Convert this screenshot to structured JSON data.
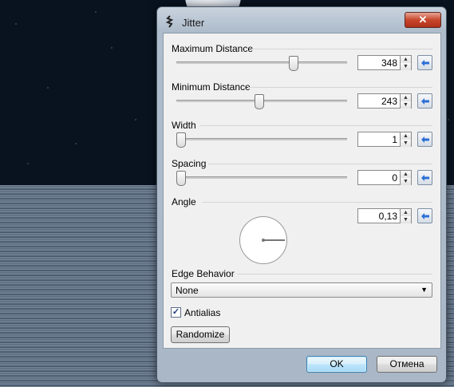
{
  "dialog": {
    "title": "Jitter",
    "close_glyph": "✕"
  },
  "fields": {
    "max_distance": {
      "label": "Maximum Distance",
      "value": "348",
      "slider_fraction": 0.69
    },
    "min_distance": {
      "label": "Minimum Distance",
      "value": "243",
      "slider_fraction": 0.48
    },
    "width": {
      "label": "Width",
      "value": "1",
      "slider_fraction": 0.0
    },
    "spacing": {
      "label": "Spacing",
      "value": "0",
      "slider_fraction": 0.0
    },
    "angle": {
      "label": "Angle",
      "value": "0,13"
    }
  },
  "spin_up_glyph": "▲",
  "spin_down_glyph": "▼",
  "edge_behavior": {
    "label": "Edge Behavior",
    "selected": "None",
    "arrow_glyph": "▼"
  },
  "antialias": {
    "label": "Antialias",
    "checked": true,
    "check_glyph": "✓"
  },
  "buttons": {
    "randomize": "Randomize",
    "ok": "OK",
    "cancel": "Отмена"
  },
  "icons": {
    "title_icon": "jitter-app-icon",
    "reset": "reset-arrow-icon",
    "close": "close-icon"
  },
  "colors": {
    "reset_arrow": "#2a6fd6",
    "ok_border": "#3c7fb1"
  }
}
